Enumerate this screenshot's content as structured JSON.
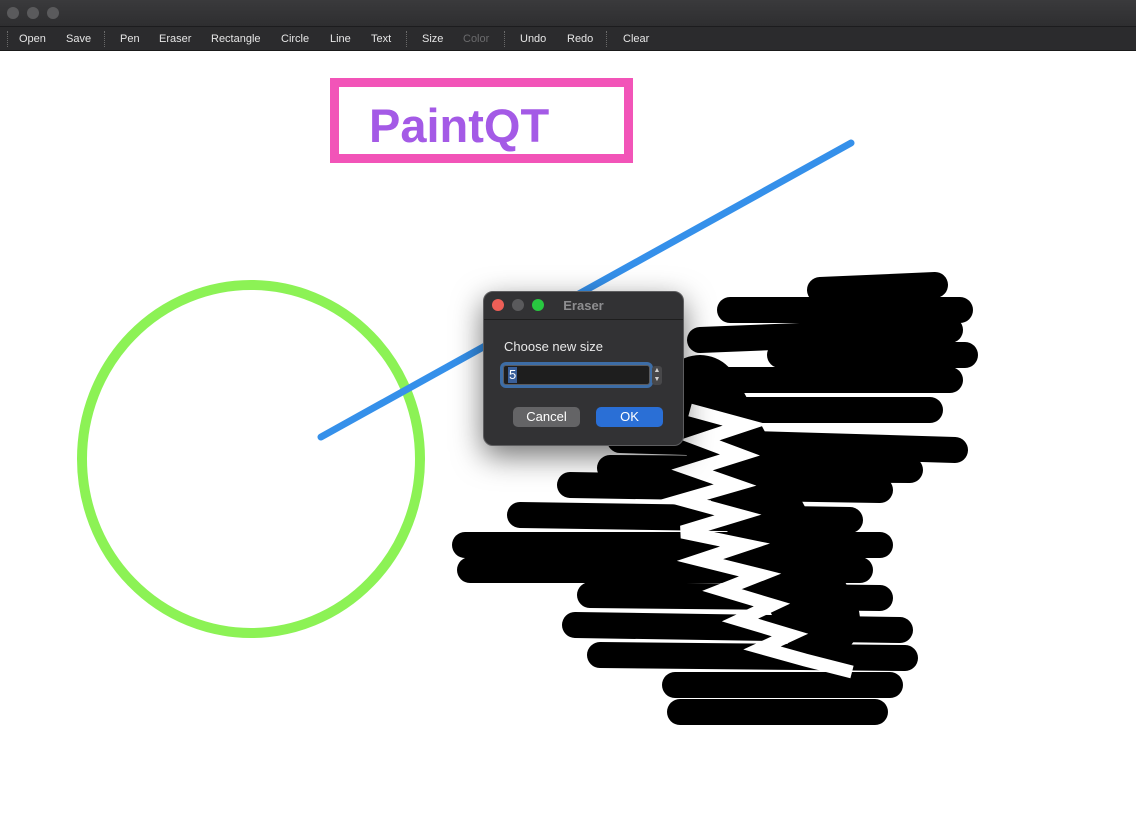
{
  "window": {
    "traffic_lights": [
      "close",
      "minimize",
      "zoom"
    ]
  },
  "toolbar": {
    "items": [
      {
        "label": "Open",
        "enabled": true
      },
      {
        "label": "Save",
        "enabled": true
      },
      {
        "label": "Pen",
        "enabled": true
      },
      {
        "label": "Eraser",
        "enabled": true
      },
      {
        "label": "Rectangle",
        "enabled": true
      },
      {
        "label": "Circle",
        "enabled": true
      },
      {
        "label": "Line",
        "enabled": true
      },
      {
        "label": "Text",
        "enabled": true
      },
      {
        "label": "Size",
        "enabled": true
      },
      {
        "label": "Color",
        "enabled": false
      },
      {
        "label": "Undo",
        "enabled": true
      },
      {
        "label": "Redo",
        "enabled": true
      },
      {
        "label": "Clear",
        "enabled": true
      }
    ]
  },
  "canvas": {
    "text_drawing": "PaintQT",
    "colors": {
      "rectangle": "#f254b8",
      "text": "#a45ae6",
      "line": "#3590ea",
      "circle": "#8cf255",
      "scribble": "#000000",
      "eraser": "#ffffff"
    }
  },
  "dialog": {
    "title": "Eraser",
    "prompt": "Choose new size",
    "value": "5",
    "cancel_label": "Cancel",
    "ok_label": "OK",
    "colors": {
      "close": "#ed5f57",
      "minimize": "#5a5a5c",
      "zoom": "#28c840",
      "accent": "#2a6fd6"
    }
  }
}
